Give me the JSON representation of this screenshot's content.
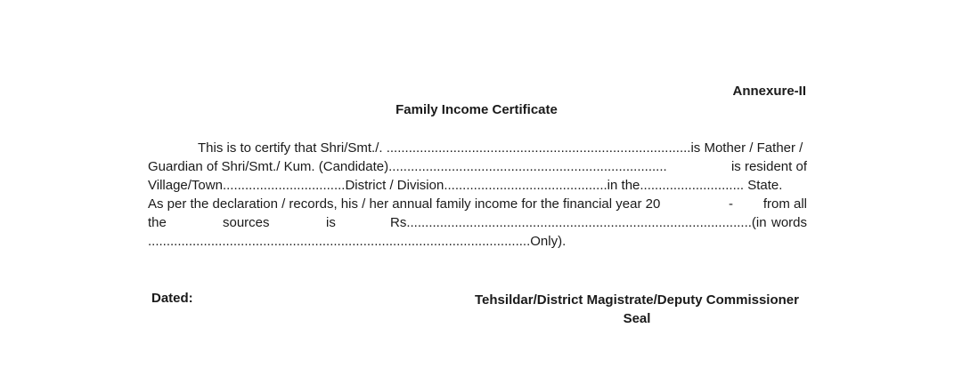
{
  "annexure": "Annexure-II",
  "title": "Family Income Certificate",
  "body": {
    "line1": {
      "a": "This is to certify that Shri/Smt./. ..................................................................................is Mother / Father /"
    },
    "line2": {
      "a": "Guardian of Shri/Smt./ Kum. (Candidate)...........................................................................",
      "b": "is resident of"
    },
    "line3": {
      "a": "Village/Town.................................District / Division............................................in the............................ State."
    },
    "line4": {
      "a": "As per the declaration / records, his / her annual family income for the financial year 20",
      "b": "-",
      "c": "from all"
    },
    "line5": {
      "a": "the",
      "b": "sources",
      "c": "is",
      "d": "Rs.............................................................................................(in",
      "e": "words"
    },
    "line6": {
      "a": ".......................................................................................................Only)."
    }
  },
  "footer": {
    "dated_label": "Dated:",
    "authority": "Tehsildar/District Magistrate/Deputy Commissioner",
    "seal": "Seal"
  }
}
